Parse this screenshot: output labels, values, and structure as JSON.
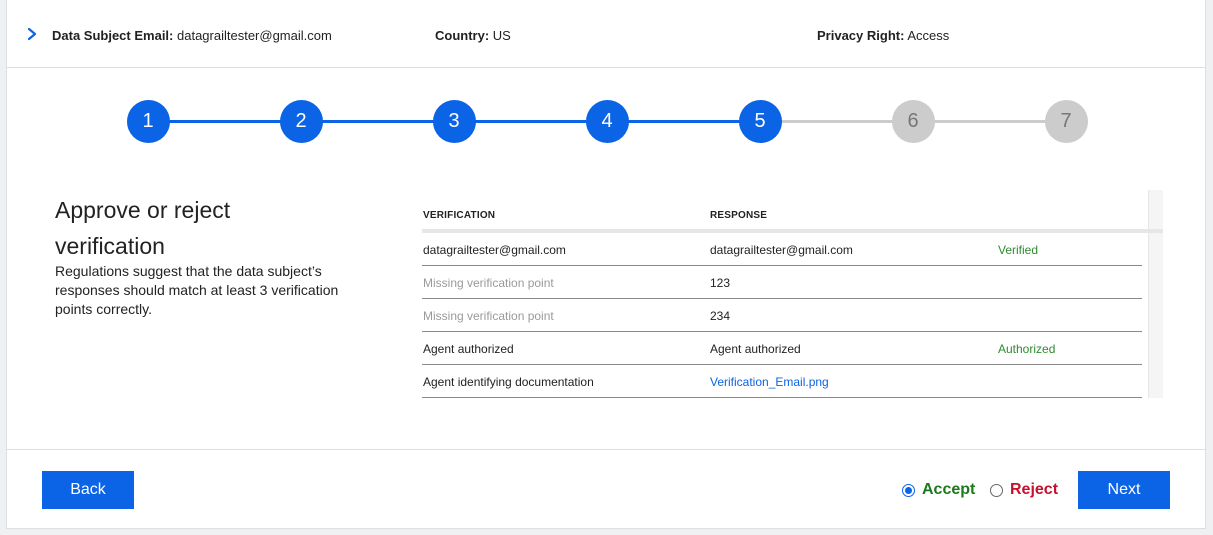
{
  "header": {
    "email_label": "Data Subject Email:",
    "email_value": "datagrailtester@gmail.com",
    "country_label": "Country:",
    "country_value": "US",
    "right_label": "Privacy Right:",
    "right_value": "Access"
  },
  "stepper": {
    "steps": [
      "1",
      "2",
      "3",
      "4",
      "5",
      "6",
      "7"
    ],
    "current_step": 5,
    "colors": {
      "done": "#0b63e5",
      "todo": "#cccccc"
    }
  },
  "section": {
    "title": "Approve or reject verification",
    "description": "Regulations suggest that the data subject’s responses should match at least 3 verification points correctly."
  },
  "table": {
    "headers": {
      "verification": "VERIFICATION",
      "response": "RESPONSE"
    },
    "rows": [
      {
        "verification": "datagrailtester@gmail.com",
        "response": "datagrailtester@gmail.com",
        "status": "Verified"
      },
      {
        "verification": "Missing verification point",
        "response": "123",
        "status": ""
      },
      {
        "verification": "Missing verification point",
        "response": "234",
        "status": ""
      },
      {
        "verification": "Agent authorized",
        "response": "Agent authorized",
        "status": "Authorized"
      },
      {
        "verification": "Agent identifying documentation",
        "response": "Verification_Email.png",
        "status": ""
      }
    ]
  },
  "footer": {
    "back_label": "Back",
    "accept_label": "Accept",
    "reject_label": "Reject",
    "next_label": "Next",
    "selected": "accept",
    "accept_color": "#1a7a1a",
    "reject_color": "#c8102e"
  }
}
